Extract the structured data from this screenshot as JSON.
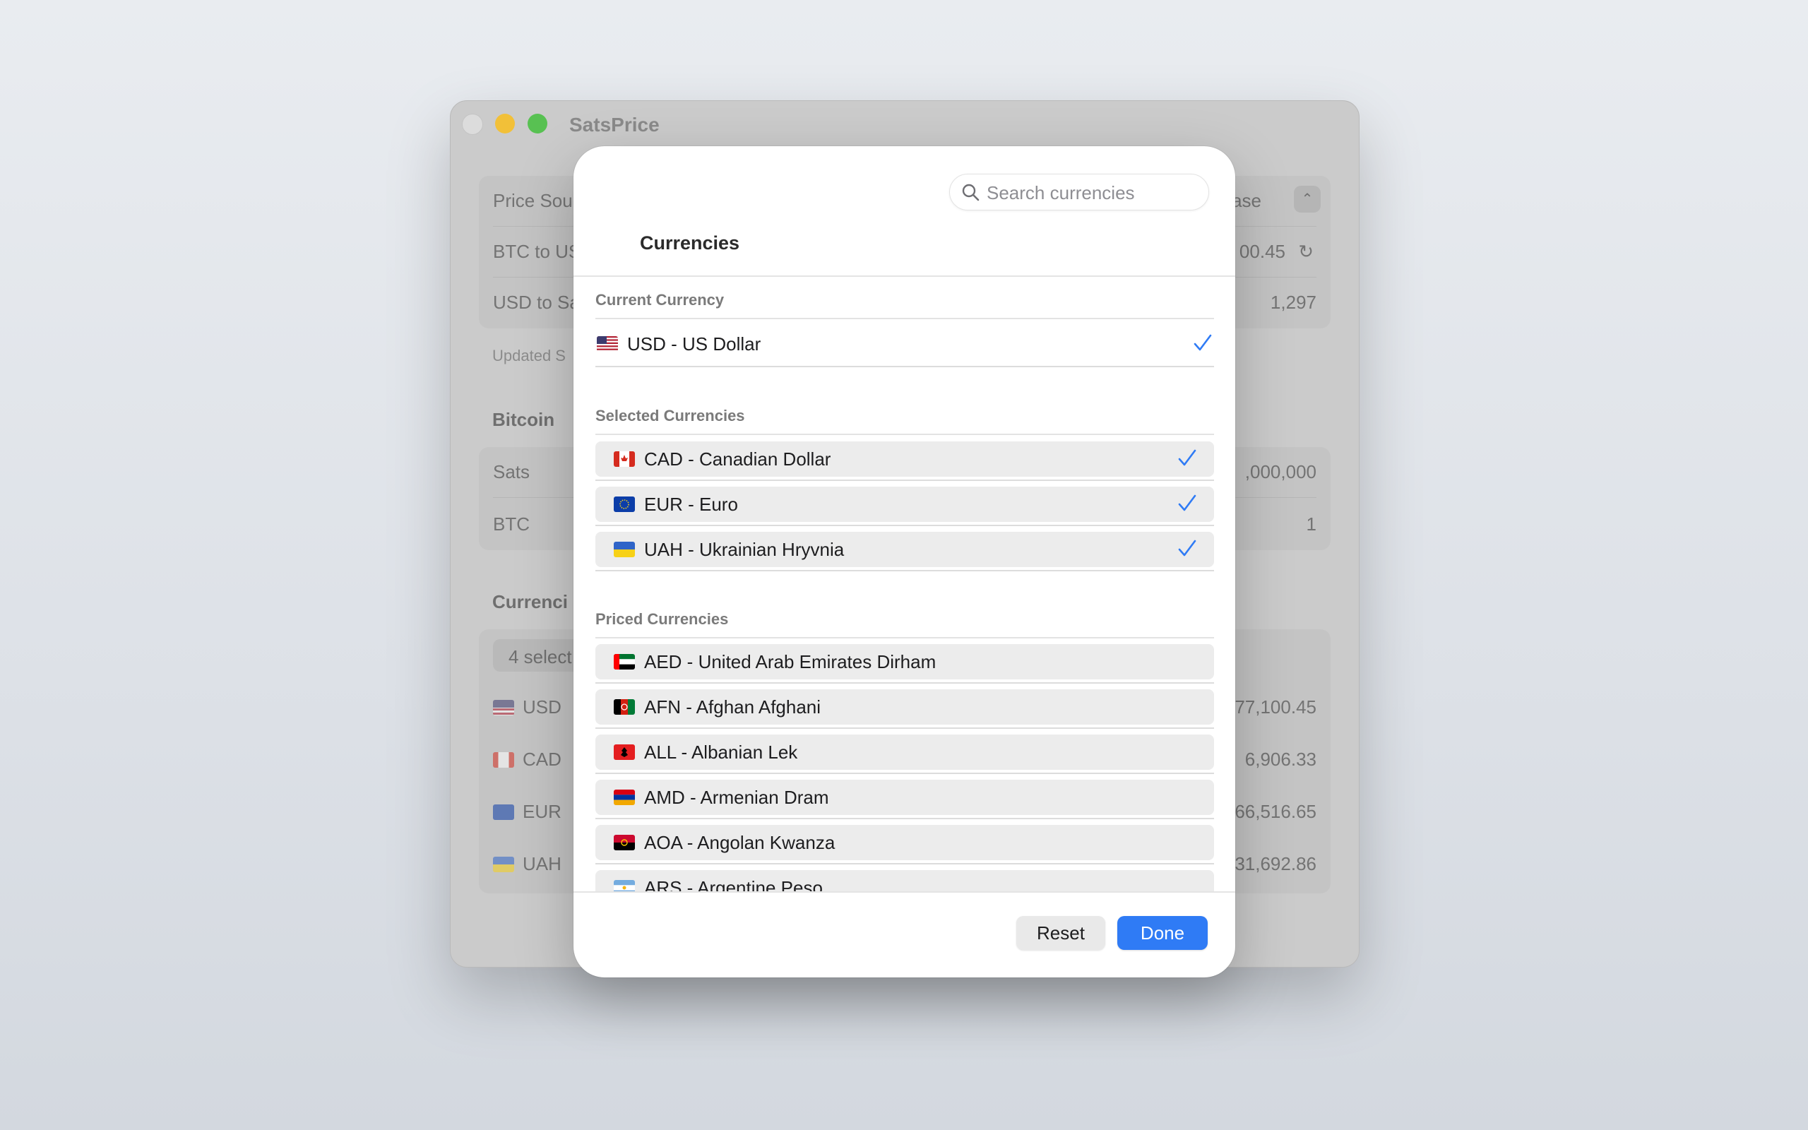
{
  "background_window": {
    "title": "SatsPrice",
    "rows": {
      "price_source_label": "Price Sou",
      "price_source_value": "ase",
      "btc_to_usd_label": "BTC to US",
      "btc_to_usd_value": "00.45",
      "usd_to_sats_label": "USD to Sa",
      "usd_to_sats_value": "1,297",
      "updated_label": "Updated S"
    },
    "bitcoin": {
      "header": "Bitcoin",
      "sats_label": "Sats",
      "sats_value": ",000,000",
      "btc_label": "BTC",
      "btc_value": "1"
    },
    "currencies": {
      "header": "Currenci",
      "chip": "4 select",
      "items": [
        {
          "code": "USD",
          "value": "77,100.45"
        },
        {
          "code": "CAD",
          "value": "6,906.33"
        },
        {
          "code": "EUR",
          "value": "66,516.65"
        },
        {
          "code": "UAH",
          "value": "31,692.86"
        }
      ]
    }
  },
  "sheet": {
    "search": {
      "placeholder": "Search currencies"
    },
    "title": "Currencies",
    "current_section": {
      "title": "Current Currency",
      "item": {
        "label": "USD - US Dollar",
        "flag": "us",
        "checked": true
      }
    },
    "selected_section": {
      "title": "Selected Currencies",
      "items": [
        {
          "label": "CAD - Canadian Dollar",
          "flag": "ca",
          "checked": true
        },
        {
          "label": "EUR - Euro",
          "flag": "eu",
          "checked": true
        },
        {
          "label": "UAH - Ukrainian Hryvnia",
          "flag": "ua",
          "checked": true
        }
      ]
    },
    "priced_section": {
      "title": "Priced Currencies",
      "items": [
        {
          "label": "AED - United Arab Emirates Dirham",
          "flag": "ae"
        },
        {
          "label": "AFN - Afghan Afghani",
          "flag": "af"
        },
        {
          "label": "ALL - Albanian Lek",
          "flag": "al"
        },
        {
          "label": "AMD - Armenian Dram",
          "flag": "am"
        },
        {
          "label": "AOA - Angolan Kwanza",
          "flag": "ao"
        },
        {
          "label": "ARS - Argentine Peso",
          "flag": "ar"
        }
      ]
    },
    "buttons": {
      "reset": "Reset",
      "done": "Done"
    }
  },
  "colors": {
    "accent": "#2f7bf5",
    "checkmark": "#2f7bf5",
    "row_fill": "#ececec"
  }
}
